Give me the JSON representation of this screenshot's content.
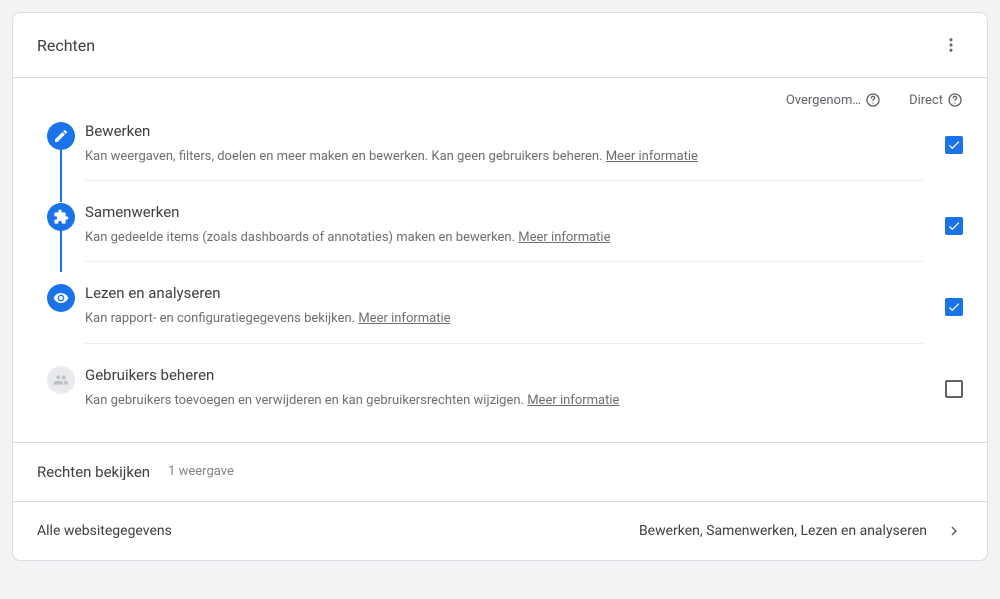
{
  "header": {
    "title": "Rechten"
  },
  "columns": {
    "inherited": "Overgenom…",
    "direct": "Direct"
  },
  "permissions": [
    {
      "key": "edit",
      "title": "Bewerken",
      "desc": "Kan weergaven, filters, doelen en meer maken en bewerken. Kan geen gebruikers beheren. ",
      "more": "Meer informatie",
      "active": true,
      "checked": true,
      "icon": "pencil"
    },
    {
      "key": "collaborate",
      "title": "Samenwerken",
      "desc": "Kan gedeelde items (zoals dashboards of annotaties) maken en bewerken. ",
      "more": "Meer informatie",
      "active": true,
      "checked": true,
      "icon": "puzzle"
    },
    {
      "key": "read",
      "title": "Lezen en analyseren",
      "desc": "Kan rapport- en configuratiegegevens bekijken. ",
      "more": "Meer informatie",
      "active": true,
      "checked": true,
      "icon": "eye"
    },
    {
      "key": "manage",
      "title": "Gebruikers beheren",
      "desc": "Kan gebruikers toevoegen en verwijderen en kan gebruikersrechten wijzigen. ",
      "more": "Meer informatie",
      "active": false,
      "checked": false,
      "icon": "users"
    }
  ],
  "viewSection": {
    "title": "Rechten bekijken",
    "count": "1 weergave"
  },
  "views": [
    {
      "name": "Alle websitegegevens",
      "summary": "Bewerken, Samenwerken, Lezen en analyseren"
    }
  ]
}
